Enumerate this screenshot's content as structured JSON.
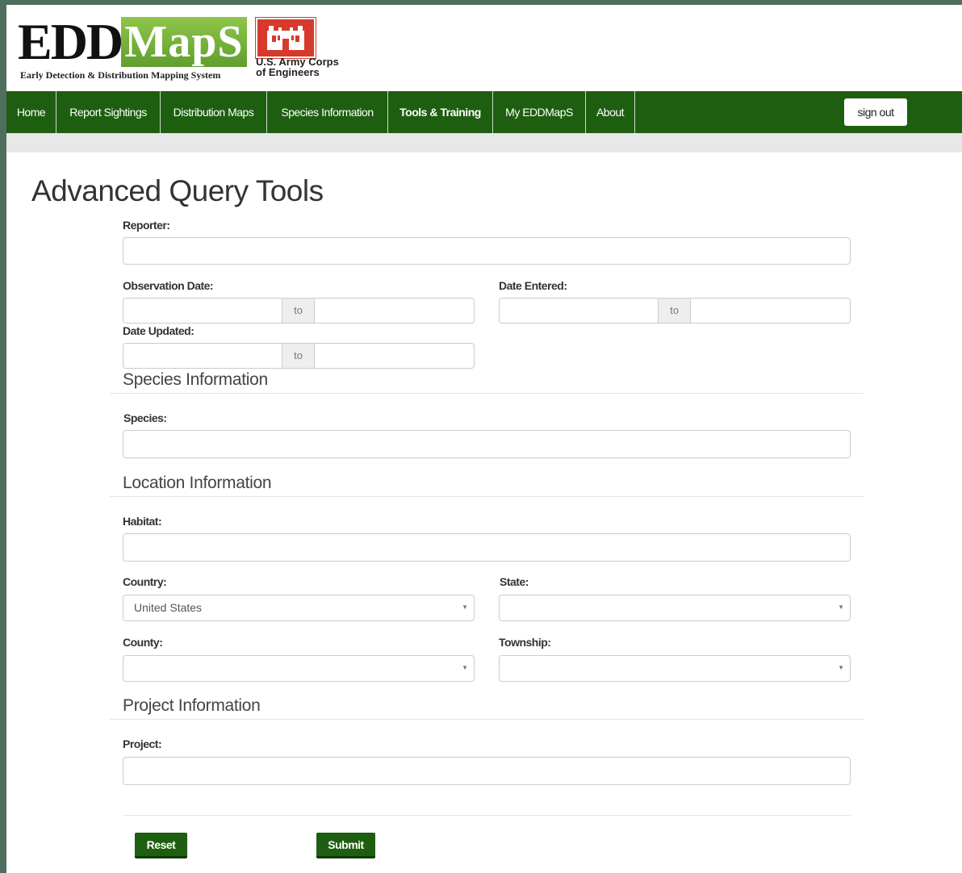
{
  "header": {
    "logo_edd": "EDD",
    "logo_maps": "MapS",
    "tagline": "Early Detection & Distribution Mapping System",
    "usace_line1": "U.S. Army Corps",
    "usace_line2": "of Engineers"
  },
  "nav": {
    "items": [
      {
        "label": "Home"
      },
      {
        "label": "Report Sightings"
      },
      {
        "label": "Distribution Maps"
      },
      {
        "label": "Species Information"
      },
      {
        "label": "Tools & Training"
      },
      {
        "label": "My EDDMapS"
      },
      {
        "label": "About"
      }
    ],
    "signout_label": "sign out",
    "bg_color": "#1e5e10"
  },
  "main": {
    "title": "Advanced Query Tools",
    "reporter_label": "Reporter:",
    "observation_date_label": "Observation Date:",
    "date_entered_label": "Date Entered:",
    "date_updated_label": "Date Updated:",
    "range_sep": "to",
    "species_section": "Species Information",
    "species_label": "Species:",
    "location_section": "Location Information",
    "habitat_label": "Habitat:",
    "country_label": "Country:",
    "country_value": "United States",
    "state_label": "State:",
    "county_label": "County:",
    "township_label": "Township:",
    "project_section": "Project Information",
    "project_label": "Project:",
    "reset_label": "Reset",
    "submit_label": "Submit"
  }
}
